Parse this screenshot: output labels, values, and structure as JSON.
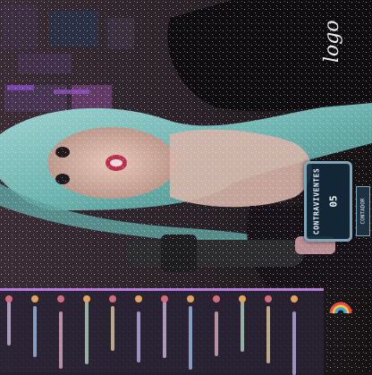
{
  "stream": {
    "counter": {
      "title": "CONTRAVIVENTES",
      "value": "05",
      "tag": "CONTADOR"
    },
    "chat": {
      "visible_lines": 12
    },
    "colors": {
      "hair_teal": "#6fb4b0",
      "counter_border": "#7fa6b8",
      "counter_bg": "#12283a",
      "chat_border": "#b57cd8"
    },
    "icons": [
      "rainbow-icon",
      "emote-icon"
    ]
  }
}
